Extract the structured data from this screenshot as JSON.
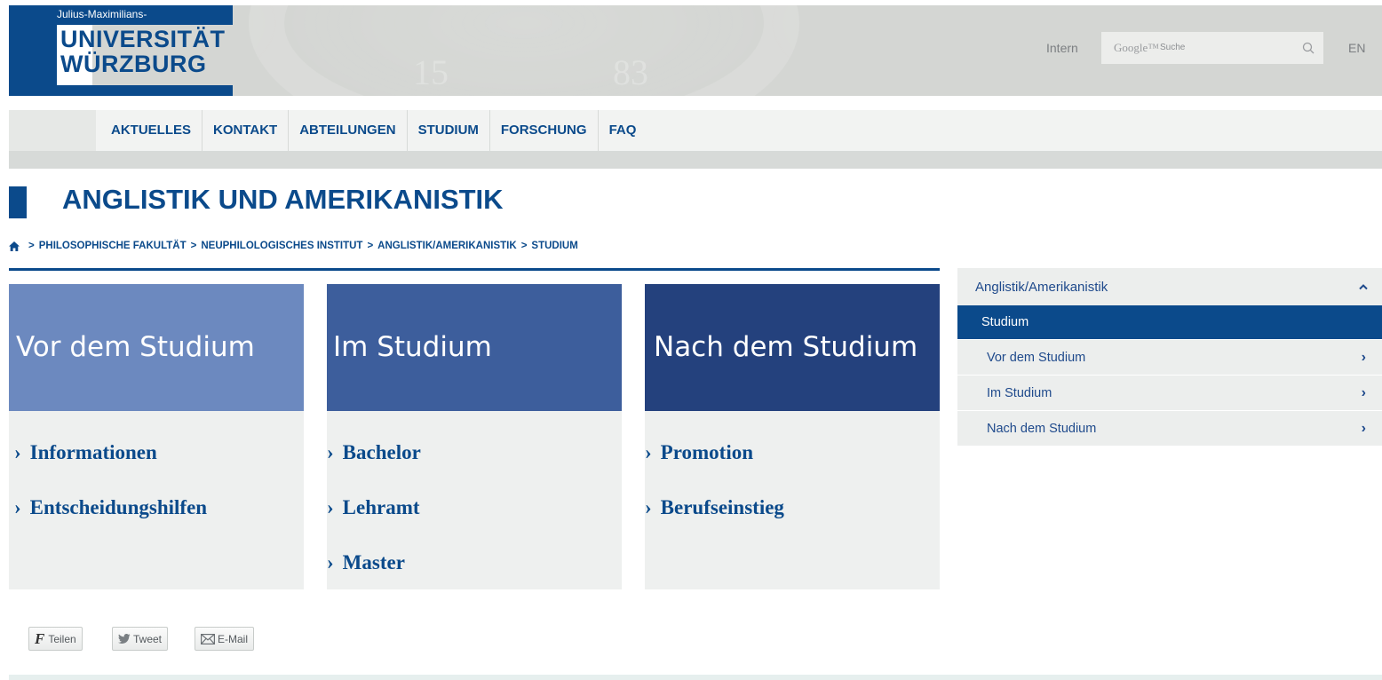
{
  "header": {
    "logo_small": "Julius-Maximilians-",
    "logo_line1": "UNIVERSITÄT",
    "logo_line2": "WÜRZBURG",
    "intern_label": "Intern",
    "search_brand": "Google™",
    "search_placeholder": "Suche",
    "lang_label": "EN"
  },
  "nav": {
    "items": [
      "AKTUELLES",
      "KONTAKT",
      "ABTEILUNGEN",
      "STUDIUM",
      "FORSCHUNG",
      "FAQ"
    ]
  },
  "page": {
    "title": "ANGLISTIK UND AMERIKANISTIK",
    "breadcrumb": [
      "PHILOSOPHISCHE FAKULTÄT",
      "NEUPHILOLOGISCHES INSTITUT",
      "ANGLISTIK/AMERIKANISTIK",
      "STUDIUM"
    ]
  },
  "cards": [
    {
      "title": "Vor dem Studium",
      "color": "#6c89bf",
      "links": [
        "Informationen",
        "Entscheidungshilfen"
      ]
    },
    {
      "title": "Im Studium",
      "color": "#3d5e9c",
      "links": [
        "Bachelor",
        "Lehramt",
        "Master"
      ]
    },
    {
      "title": "Nach dem Studium",
      "color": "#24417d",
      "links": [
        "Promotion",
        "Berufseinstieg"
      ]
    }
  ],
  "sidebar": {
    "parent": "Anglistik/Amerikanistik",
    "active": "Studium",
    "items": [
      "Vor dem Studium",
      "Im Studium",
      "Nach dem Studium"
    ]
  },
  "share": {
    "facebook": "Teilen",
    "twitter": "Tweet",
    "email": "E-Mail"
  },
  "colors": {
    "brand": "#0b4a8b",
    "header_bg": "#d4d6d3"
  }
}
